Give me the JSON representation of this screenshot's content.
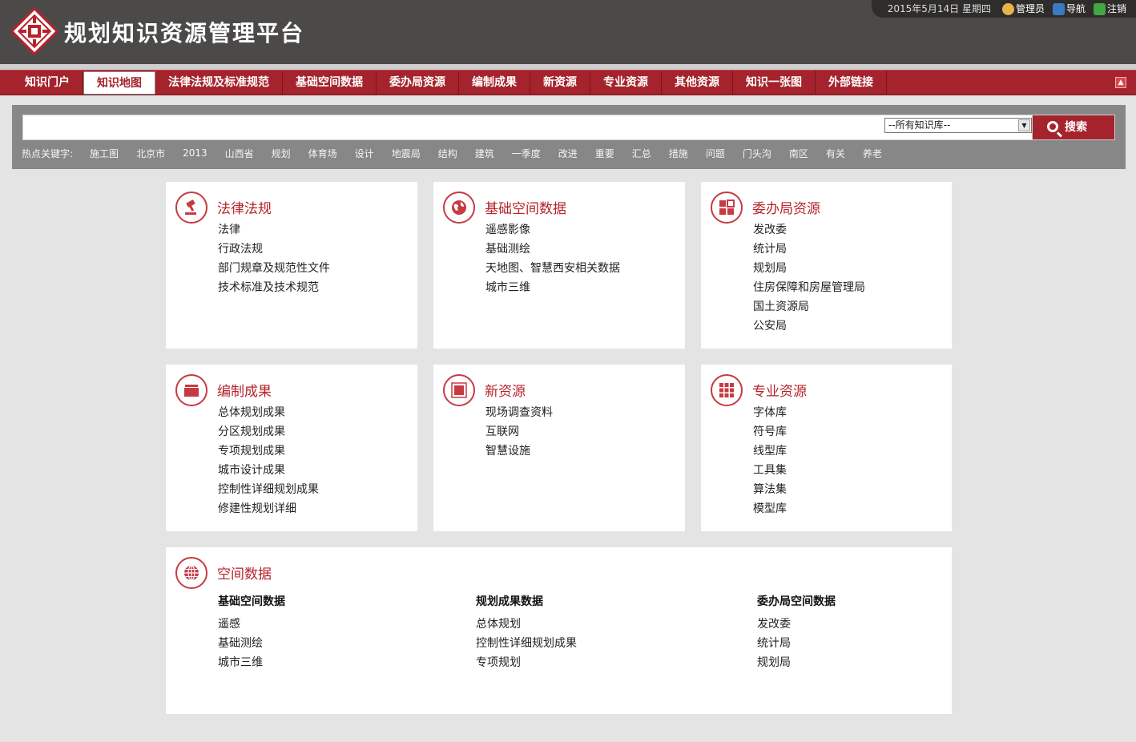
{
  "app": {
    "title": "规划知识资源管理平台"
  },
  "topbar": {
    "date": "2015年5月14日  星期四",
    "user": "管理员",
    "nav": "导航",
    "logout": "注销"
  },
  "nav": [
    {
      "label": "知识门户"
    },
    {
      "label": "知识地图",
      "active": true
    },
    {
      "label": "法律法规及标准规范"
    },
    {
      "label": "基础空间数据"
    },
    {
      "label": "委办局资源"
    },
    {
      "label": "编制成果"
    },
    {
      "label": "新资源"
    },
    {
      "label": "专业资源"
    },
    {
      "label": "其他资源"
    },
    {
      "label": "知识一张图"
    },
    {
      "label": "外部链接"
    }
  ],
  "search": {
    "value": "",
    "scope": "--所有知识库--",
    "button": "搜索",
    "hot_label": "热点关键字:",
    "hot": [
      "施工图",
      "北京市",
      "2013",
      "山西省",
      "规划",
      "体育场",
      "设计",
      "地震局",
      "结构",
      "建筑",
      "一季度",
      "改进",
      "重要",
      "汇总",
      "措施",
      "问题",
      "门头沟",
      "南区",
      "有关",
      "养老"
    ]
  },
  "cards": [
    {
      "title": "法律法规",
      "icon": "gavel-icon",
      "items": [
        "法律",
        "行政法规",
        "部门规章及规范性文件",
        "技术标准及技术规范"
      ]
    },
    {
      "title": "基础空间数据",
      "icon": "globe-icon",
      "items": [
        "遥感影像",
        "基础测绘",
        "天地图、智慧西安相关数据",
        "城市三维"
      ]
    },
    {
      "title": "委办局资源",
      "icon": "blocks-icon",
      "items": [
        "发改委",
        "统计局",
        "规划局",
        "住房保障和房屋管理局",
        "国土资源局",
        "公安局"
      ]
    },
    {
      "title": "编制成果",
      "icon": "folder-icon",
      "items": [
        "总体规划成果",
        "分区规划成果",
        "专项规划成果",
        "城市设计成果",
        "控制性详细规划成果",
        "修建性规划详细"
      ]
    },
    {
      "title": "新资源",
      "icon": "frame-icon",
      "items": [
        "现场调查资料",
        "互联网",
        "智慧设施"
      ]
    },
    {
      "title": "专业资源",
      "icon": "grid-icon",
      "items": [
        "字体库",
        "符号库",
        "线型库",
        "工具集",
        "算法集",
        "模型库"
      ]
    }
  ],
  "spatial": {
    "title": "空间数据",
    "icon": "globe-grid-icon",
    "columns": [
      {
        "head": "基础空间数据",
        "items": [
          "遥感",
          "基础测绘",
          "城市三维"
        ]
      },
      {
        "head": "规划成果数据",
        "items": [
          "总体规划",
          "控制性详细规划成果",
          "专项规划"
        ]
      },
      {
        "head": "委办局空间数据",
        "items": [
          "发改委",
          "统计局",
          "规划局"
        ]
      }
    ]
  },
  "colors": {
    "brand_red": "#a5232c",
    "header_bg": "#4b4a49",
    "search_bg": "#878787",
    "page_bg": "#e4e4e4"
  }
}
